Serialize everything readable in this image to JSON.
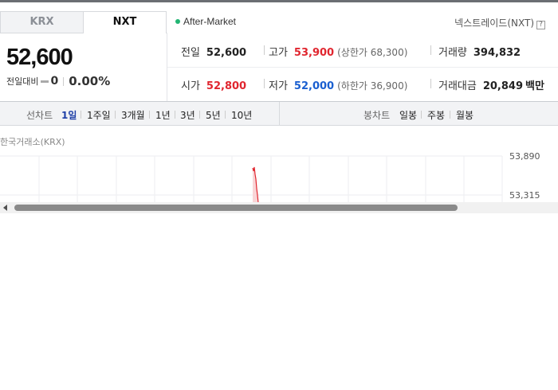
{
  "market_tabs": [
    {
      "label": "KRX",
      "active": false
    },
    {
      "label": "NXT",
      "active": true
    }
  ],
  "session": {
    "label": "After-Market",
    "dot_color": "#22b573"
  },
  "provider": {
    "label": "넥스트레이드(NXT)",
    "help": "?"
  },
  "price": {
    "current": "52,600",
    "change_label": "전일대비",
    "change_amount": "0",
    "change_pct": "0.00%"
  },
  "stats": {
    "prev_close": {
      "label": "전일",
      "value": "52,600"
    },
    "high": {
      "label": "고가",
      "value": "53,900",
      "limit": "(상한가 68,300)"
    },
    "volume": {
      "label": "거래량",
      "value": "394,832"
    },
    "open": {
      "label": "시가",
      "value": "52,800"
    },
    "low": {
      "label": "저가",
      "value": "52,000",
      "limit": "(하한가 36,900)"
    },
    "trade_value": {
      "label": "거래대금",
      "value": "20,849",
      "unit": "백만"
    }
  },
  "line_chart_tabs": {
    "label": "선차트",
    "options": [
      "1일",
      "1주일",
      "3개월",
      "1년",
      "3년",
      "5년",
      "10년"
    ],
    "active": "1일"
  },
  "candle_chart_tabs": {
    "label": "봉차트",
    "options": [
      "일봉",
      "주봉",
      "월봉"
    ]
  },
  "chart": {
    "source": "한국거래소(KRX)",
    "y_ticks": [
      "53,890",
      "53,315"
    ],
    "up_color": "#e0262f"
  }
}
